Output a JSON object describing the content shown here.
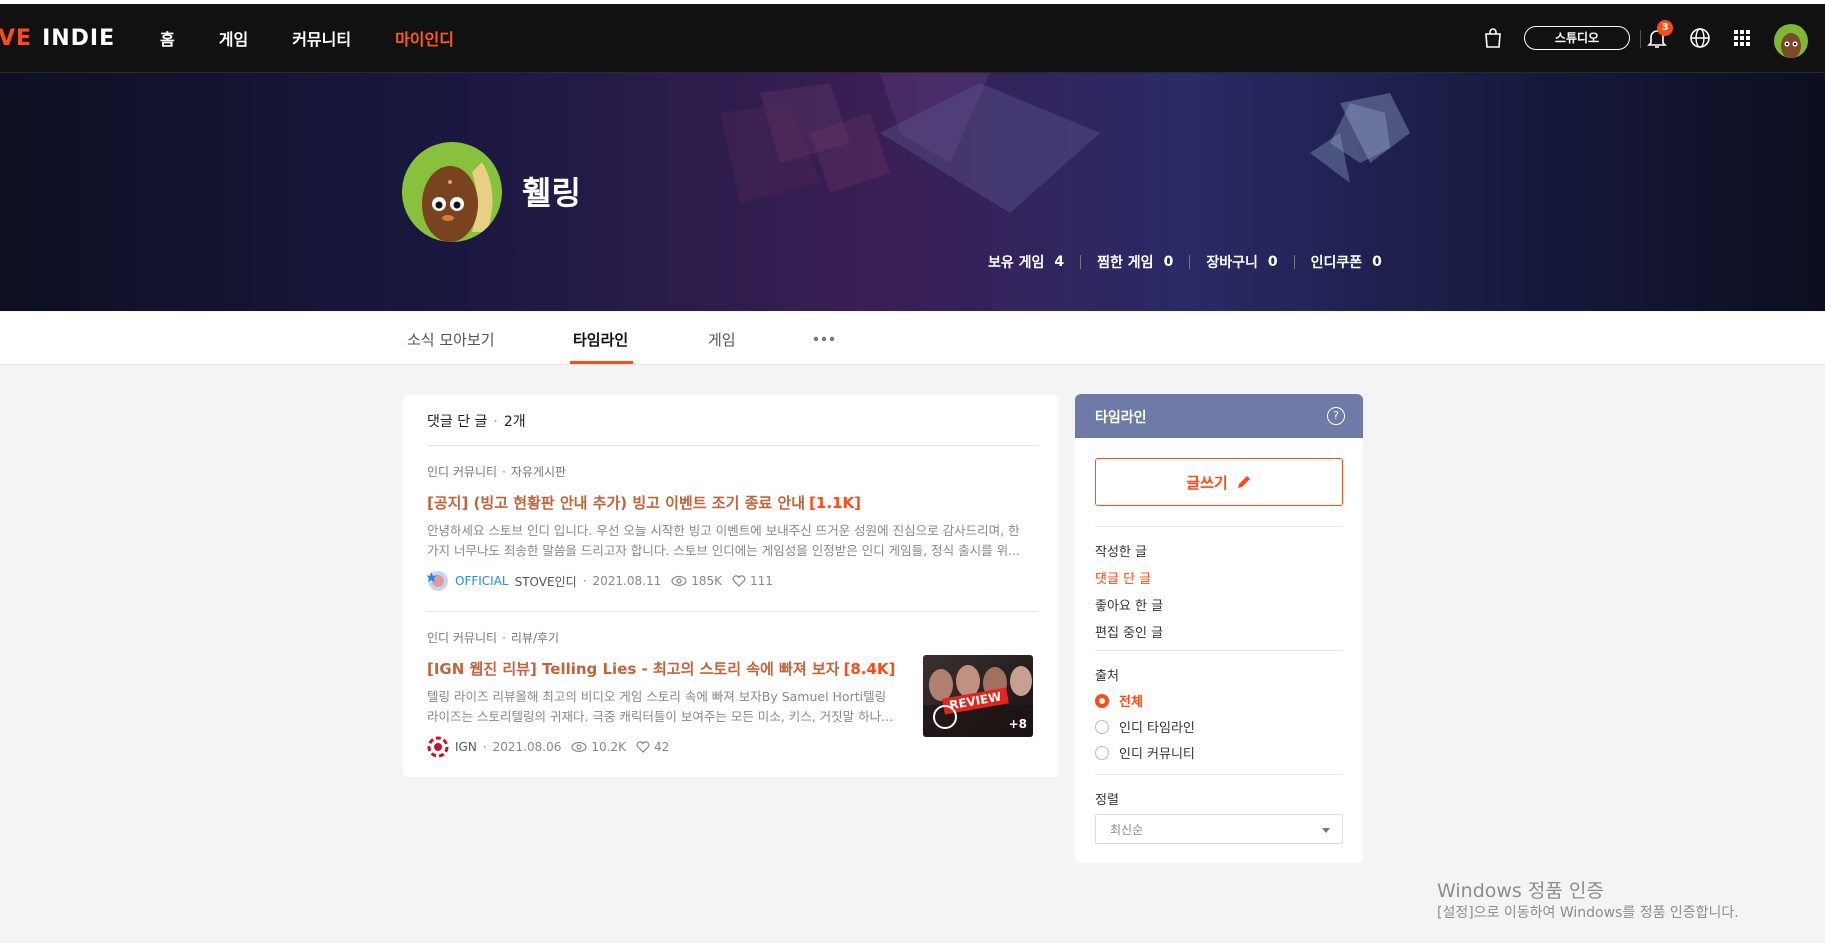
{
  "header": {
    "logo_part1": "VE",
    "logo_part2": "INDIE",
    "nav": [
      {
        "label": "홈"
      },
      {
        "label": "게임"
      },
      {
        "label": "커뮤니티"
      },
      {
        "label": "마이인디",
        "active": true
      }
    ],
    "studio_label": "스튜디오",
    "notification_count": "3",
    "icons": [
      "cart-icon",
      "bell-icon",
      "globe-icon",
      "grid-icon",
      "avatar"
    ]
  },
  "profile": {
    "nickname": "휄링",
    "stats": [
      {
        "label": "보유 게임",
        "value": "4"
      },
      {
        "label": "찜한 게임",
        "value": "0"
      },
      {
        "label": "장바구니",
        "value": "0"
      },
      {
        "label": "인디쿠폰",
        "value": "0"
      }
    ]
  },
  "tabs": [
    {
      "label": "소식 모아보기"
    },
    {
      "label": "타임라인",
      "active": true
    },
    {
      "label": "게임"
    }
  ],
  "main": {
    "heading": "댓글 단 글",
    "count": "2개",
    "posts": [
      {
        "board": "인디 커뮤니티",
        "category": "자유게시판",
        "title": "[공지] (빙고 현황판 안내 추가) 빙고 이벤트 조기 종료 안내",
        "comment_count": "[1.1K]",
        "body_line1": " 안녕하세요 스토브 인디 입니다.  우선 오늘 시작한 빙고 이벤트에 보내주신 뜨거운 성원에 진심으로 감사드리며, 한",
        "body_line2": "가지 너무나도 죄송한 말씀을 드리고자 합니다.  스토브 인디에는 게임성을 인정받은 인디 게임들, 정식 출시를 위...",
        "official": "OFFICIAL",
        "author": "STOVE인디",
        "date": "2021.08.11",
        "views": "185K",
        "likes": "111"
      },
      {
        "board": "인디 커뮤니티",
        "category": "리뷰/후기",
        "title": "[IGN 웹진 리뷰] Telling Lies - 최고의 스토리 속에 빠져 보자",
        "comment_count": "[8.4K]",
        "body_line1": "텔링 라이즈 리뷰올해 최고의 비디오 게임 스토리 속에 빠져 보자By Samuel Horti텔링",
        "body_line2": "라이즈는 스토리텔링의 귀재다. 극중 캐릭터들이 보여주는 모든 미소, 키스, 거짓말 하나...",
        "author": "IGN",
        "date": "2021.08.06",
        "views": "10.2K",
        "likes": "42",
        "thumb_label": "REVIEW",
        "thumb_more": "+8"
      }
    ]
  },
  "sidebar": {
    "title": "타임라인",
    "help": "?",
    "write_label": "글쓰기",
    "links": [
      {
        "label": "작성한 글"
      },
      {
        "label": "댓글 단 글",
        "active": true
      },
      {
        "label": "좋아요 한 글"
      },
      {
        "label": "편집 중인 글"
      }
    ],
    "source_label": "출처",
    "sources": [
      {
        "label": "전체",
        "checked": true
      },
      {
        "label": "인디 타임라인"
      },
      {
        "label": "인디 커뮤니티"
      }
    ],
    "sort_label": "정렬",
    "sort_value": "최신순"
  },
  "watermark": {
    "line1": "Windows 정품 인증",
    "line2": "[설정]으로 이동하여 Windows를 정품 인증합니다."
  },
  "colors": {
    "accent": "#ff4b17",
    "header_bg": "#111111",
    "sidebar_head": "#6e7aa8"
  }
}
